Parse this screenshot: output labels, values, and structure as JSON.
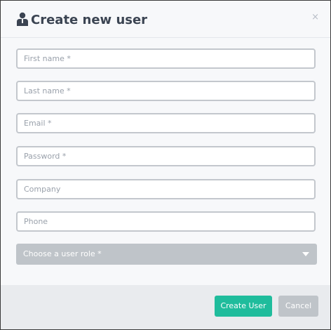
{
  "dialog": {
    "title": "Create new user",
    "close_label": "×"
  },
  "form": {
    "first_name": {
      "placeholder": "First name *",
      "value": ""
    },
    "last_name": {
      "placeholder": "Last name *",
      "value": ""
    },
    "email": {
      "placeholder": "Email *",
      "value": ""
    },
    "password": {
      "placeholder": "Password *",
      "value": ""
    },
    "company": {
      "placeholder": "Company",
      "value": ""
    },
    "phone": {
      "placeholder": "Phone",
      "value": ""
    },
    "role": {
      "selected_label": "Choose a user role *"
    }
  },
  "footer": {
    "create_label": "Create User",
    "cancel_label": "Cancel"
  },
  "icons": {
    "header": "user-icon",
    "close": "close-icon",
    "dropdown": "chevron-down-icon"
  },
  "colors": {
    "primary": "#1fbc9c",
    "secondary": "#bfc4c9",
    "title": "#3b4452",
    "field_border": "#c3c7cd"
  }
}
